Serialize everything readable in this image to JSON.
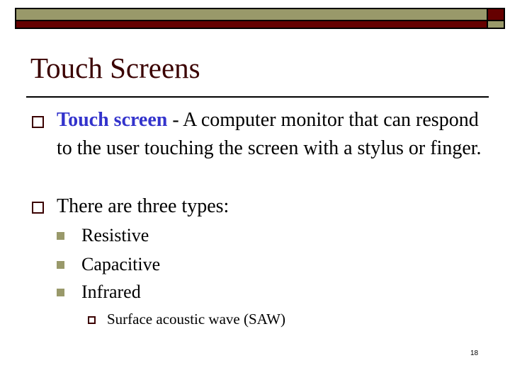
{
  "slide": {
    "title": "Touch Screens",
    "bullets": [
      {
        "term": "Touch screen",
        "text": " - A computer monitor that can respond to the user touching the screen with a stylus or finger."
      },
      {
        "text": "There are three types:",
        "sub_bullets": [
          {
            "text": "Resistive"
          },
          {
            "text": "Capacitive"
          },
          {
            "text": "Infrared",
            "sub_bullets": [
              {
                "text": "Surface acoustic wave (SAW)"
              }
            ]
          }
        ]
      }
    ],
    "page_number": "18"
  },
  "theme": {
    "accent_olive": "#99996a",
    "accent_maroon": "#650000",
    "title_color": "#3a0000",
    "term_color": "#3333cc"
  }
}
